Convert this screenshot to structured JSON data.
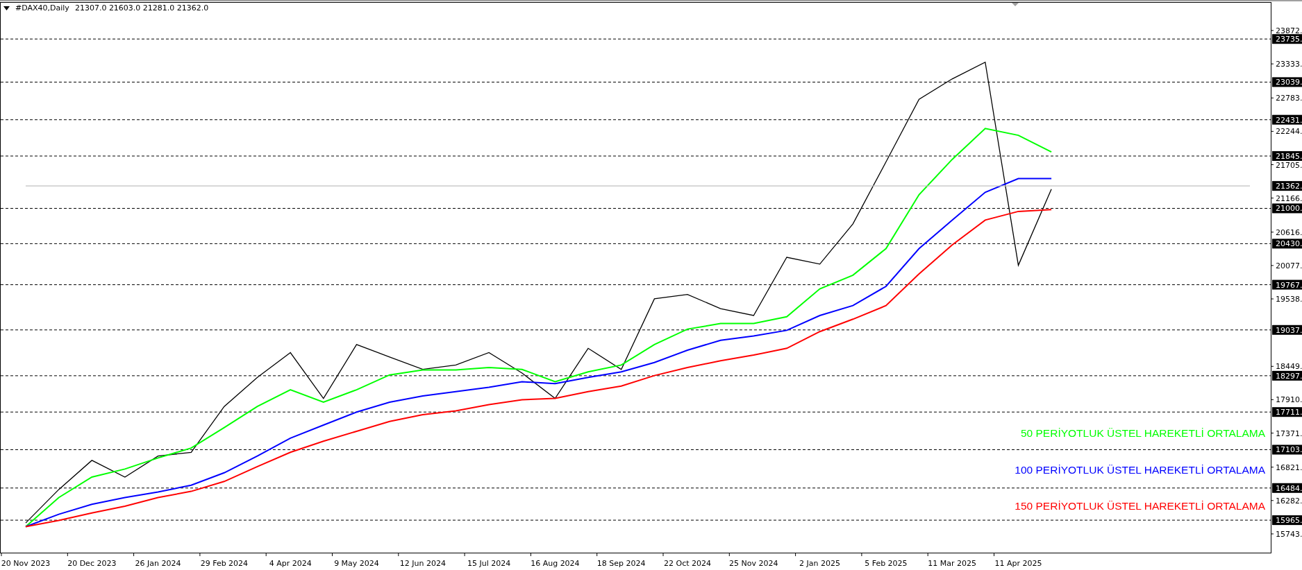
{
  "header": {
    "symbol": "#DAX40,Daily",
    "ohlc": "21307.0 21603.0 21281.0 21362.0"
  },
  "chart_data": {
    "type": "line",
    "categories": [
      "20 Nov 2023",
      null,
      "20 Dec 2023",
      null,
      "26 Jan 2024",
      null,
      "29 Feb 2024",
      null,
      "4 Apr 2024",
      null,
      "9 May 2024",
      null,
      "12 Jun 2024",
      null,
      "15 Jul 2024",
      null,
      "16 Aug 2024",
      null,
      "18 Sep 2024",
      null,
      "22 Oct 2024",
      null,
      "25 Nov 2024",
      null,
      "2 Jan 2025",
      null,
      "5 Feb 2025",
      null,
      "11 Mar 2025",
      null,
      "11 Apr 2025",
      null,
      null,
      null,
      null,
      null,
      null,
      null
    ],
    "ylim": [
      15440,
      24331
    ],
    "grid": true,
    "series": [
      {
        "color": "#000000",
        "values": [
          15920,
          16460,
          16930,
          16660,
          17000,
          17060,
          17800,
          18270,
          18670,
          17930,
          18800,
          18600,
          18400,
          18470,
          18670,
          18340,
          17930,
          18740,
          18400,
          19540,
          19610,
          19380,
          19270,
          20210,
          20100,
          20750,
          21750,
          22760,
          23090,
          23360,
          20080,
          21310,
          null,
          null,
          null,
          null,
          null,
          null
        ]
      },
      {
        "name": "50 PERİYOTLUK ÜSTEL HAREKETLİ ORTALAMA",
        "color": "#00ff00",
        "values": [
          15860,
          16330,
          16660,
          16790,
          16970,
          17130,
          17460,
          17800,
          18070,
          17870,
          18070,
          18310,
          18390,
          18390,
          18430,
          18400,
          18200,
          18360,
          18470,
          18800,
          19050,
          19140,
          19140,
          19250,
          19700,
          19920,
          20350,
          21220,
          21790,
          22290,
          22180,
          21910,
          null,
          null,
          null,
          null,
          null,
          null
        ]
      },
      {
        "name": "100 PERİYOTLUK ÜSTEL HAREKETLİ ORTALAMA",
        "color": "#0000ff",
        "values": [
          15860,
          16060,
          16220,
          16330,
          16420,
          16530,
          16730,
          17000,
          17290,
          17500,
          17710,
          17870,
          17970,
          18040,
          18110,
          18200,
          18170,
          18270,
          18360,
          18510,
          18710,
          18870,
          18940,
          19030,
          19270,
          19430,
          19740,
          20350,
          20810,
          21260,
          21480,
          21480,
          null,
          null,
          null,
          null,
          null,
          null
        ]
      },
      {
        "name": "150 PERİYOTLUK ÜSTEL HAREKETLİ ORTALAMA",
        "color": "#ff0000",
        "values": [
          15860,
          15960,
          16080,
          16190,
          16330,
          16430,
          16590,
          16830,
          17060,
          17240,
          17400,
          17560,
          17670,
          17730,
          17830,
          17910,
          17930,
          18040,
          18130,
          18300,
          18430,
          18540,
          18630,
          18740,
          19010,
          19210,
          19430,
          19940,
          20410,
          20810,
          20950,
          20980,
          null,
          null,
          null,
          null,
          null,
          null
        ]
      },
      {
        "color": "#c0c0c0",
        "values": [
          21362,
          21362,
          21362,
          21362,
          21362,
          21362,
          21362,
          21362,
          21362,
          21362,
          21362,
          21362,
          21362,
          21362,
          21362,
          21362,
          21362,
          21362,
          21362,
          21362,
          21362,
          21362,
          21362,
          21362,
          21362,
          21362,
          21362,
          21362,
          21362,
          21362,
          21362,
          21362,
          21362,
          21362,
          21362,
          21362,
          21362,
          21362
        ]
      }
    ],
    "yticks": [
      {
        "value": 23872,
        "label": "23872."
      },
      {
        "value": 23735,
        "label": "23735."
      },
      {
        "value": 23333,
        "label": "23333."
      },
      {
        "value": 23039,
        "label": "23039."
      },
      {
        "value": 22783,
        "label": "22783."
      },
      {
        "value": 22431,
        "label": "22431."
      },
      {
        "value": 22244,
        "label": "22244."
      },
      {
        "value": 21845,
        "label": "21845."
      },
      {
        "value": 21705,
        "label": "21705."
      },
      {
        "value": 21362,
        "label": "21362."
      },
      {
        "value": 21166,
        "label": "21166."
      },
      {
        "value": 21000,
        "label": "21000."
      },
      {
        "value": 20616,
        "label": "20616."
      },
      {
        "value": 20430,
        "label": "20430."
      },
      {
        "value": 20077,
        "label": "20077."
      },
      {
        "value": 19767,
        "label": "19767."
      },
      {
        "value": 19538,
        "label": "19538."
      },
      {
        "value": 19037,
        "label": "19037."
      },
      {
        "value": 18449,
        "label": "18449."
      },
      {
        "value": 18297,
        "label": "18297."
      },
      {
        "value": 17910,
        "label": "17910."
      },
      {
        "value": 17711,
        "label": "17711."
      },
      {
        "value": 17371,
        "label": "17371."
      },
      {
        "value": 17103,
        "label": "17103."
      },
      {
        "value": 16821,
        "label": "16821."
      },
      {
        "value": 16484,
        "label": "16484."
      },
      {
        "value": 16282,
        "label": "16282."
      },
      {
        "value": 15965,
        "label": "15965."
      },
      {
        "value": 15743,
        "label": "15743."
      }
    ]
  },
  "price_scale": [
    {
      "kind": "tick"
    },
    {
      "kind": "level"
    },
    {
      "kind": "tick"
    },
    {
      "kind": "level"
    },
    {
      "kind": "tick"
    },
    {
      "kind": "level"
    },
    {
      "kind": "tick"
    },
    {
      "kind": "level"
    },
    {
      "kind": "tick"
    },
    {
      "kind": "price"
    },
    {
      "kind": "tick"
    },
    {
      "kind": "level"
    },
    {
      "kind": "tick"
    },
    {
      "kind": "level"
    },
    {
      "kind": "tick"
    },
    {
      "kind": "level"
    },
    {
      "kind": "tick"
    },
    {
      "kind": "level"
    },
    {
      "kind": "tick"
    },
    {
      "kind": "level"
    },
    {
      "kind": "tick"
    },
    {
      "kind": "level"
    },
    {
      "kind": "tick"
    },
    {
      "kind": "level"
    },
    {
      "kind": "tick"
    },
    {
      "kind": "level"
    },
    {
      "kind": "tick"
    },
    {
      "kind": "level"
    },
    {
      "kind": "tick"
    }
  ]
}
